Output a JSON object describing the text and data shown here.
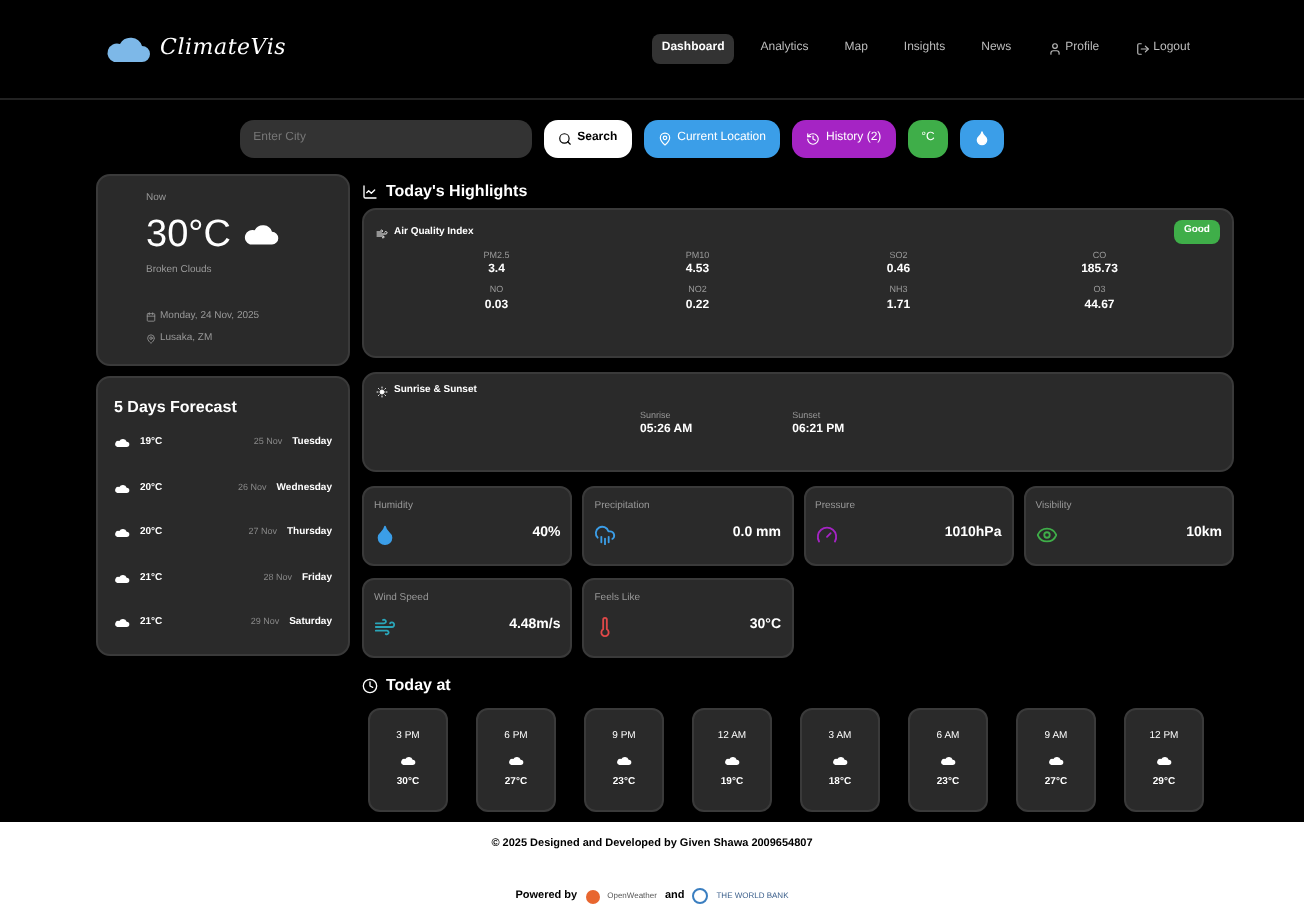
{
  "brand": {
    "name": "ClimateVis"
  },
  "nav": [
    {
      "label": "Dashboard",
      "selected": true,
      "kind": "link"
    },
    {
      "label": "Analytics",
      "selected": false,
      "kind": "link"
    },
    {
      "label": "Map",
      "selected": false,
      "kind": "link"
    },
    {
      "label": "Insights",
      "selected": false,
      "kind": "link"
    },
    {
      "label": "News",
      "selected": false,
      "kind": "link"
    },
    {
      "label": "Profile",
      "selected": false,
      "kind": "profile"
    },
    {
      "label": "Logout",
      "selected": false,
      "kind": "logout"
    }
  ],
  "search": {
    "placeholder": "Enter City"
  },
  "buttons": [
    {
      "kind": "search",
      "label": "Search"
    },
    {
      "kind": "location",
      "label": "Current Location"
    },
    {
      "kind": "history",
      "label": "History (2)"
    },
    {
      "kind": "unit",
      "label": "°C"
    },
    {
      "kind": "theme"
    }
  ],
  "current": {
    "label": "Now",
    "temp": "30°C",
    "condition": "Broken Clouds",
    "date": "Monday, 24 Nov, 2025",
    "location": "Lusaka, ZM"
  },
  "highlights_title": "Today's Highlights",
  "aqi": {
    "title": "Air Quality Index",
    "badge": "Good",
    "items": [
      {
        "label": "PM2.5",
        "value": "3.4"
      },
      {
        "label": "PM10",
        "value": "4.53"
      },
      {
        "label": "SO2",
        "value": "0.46"
      },
      {
        "label": "CO",
        "value": "185.73"
      },
      {
        "label": "NO",
        "value": "0.03"
      },
      {
        "label": "NO2",
        "value": "0.22"
      },
      {
        "label": "NH3",
        "value": "1.71"
      },
      {
        "label": "O3",
        "value": "44.67"
      }
    ]
  },
  "sun": {
    "title": "Sunrise & Sunset",
    "items": [
      {
        "label": "Sunrise",
        "value": "05:26 AM"
      },
      {
        "label": "Sunset",
        "value": "06:21 PM"
      }
    ]
  },
  "metrics": [
    {
      "kind": "humidity",
      "label": "Humidity",
      "value": "40%",
      "color": "#3b9ee8"
    },
    {
      "kind": "precipitation",
      "label": "Precipitation",
      "value": "0.0 mm",
      "color": "#3b9ee8"
    },
    {
      "kind": "pressure",
      "label": "Pressure",
      "value": "1010hPa",
      "color": "#a524c4"
    },
    {
      "kind": "visibility",
      "label": "Visibility",
      "value": "10km",
      "color": "#3fae49"
    },
    {
      "kind": "wind",
      "label": "Wind Speed",
      "value": "4.48m/s",
      "color": "#2aa5b8"
    },
    {
      "kind": "feels",
      "label": "Feels Like",
      "value": "30°C",
      "color": "#e04848"
    }
  ],
  "forecast": {
    "title": "5 Days Forecast",
    "days": [
      {
        "temp": "19°C",
        "date": "25 Nov",
        "day": "Tuesday"
      },
      {
        "temp": "20°C",
        "date": "26 Nov",
        "day": "Wednesday"
      },
      {
        "temp": "20°C",
        "date": "27 Nov",
        "day": "Thursday"
      },
      {
        "temp": "21°C",
        "date": "28 Nov",
        "day": "Friday"
      },
      {
        "temp": "21°C",
        "date": "29 Nov",
        "day": "Saturday"
      }
    ]
  },
  "today": {
    "title": "Today at",
    "hours": [
      {
        "time": "3 PM",
        "temp": "30°C"
      },
      {
        "time": "6 PM",
        "temp": "27°C"
      },
      {
        "time": "9 PM",
        "temp": "23°C"
      },
      {
        "time": "12 AM",
        "temp": "19°C"
      },
      {
        "time": "3 AM",
        "temp": "18°C"
      },
      {
        "time": "6 AM",
        "temp": "23°C"
      },
      {
        "time": "9 AM",
        "temp": "27°C"
      },
      {
        "time": "12 PM",
        "temp": "29°C"
      }
    ]
  },
  "footer": {
    "credit": "© 2025 Designed and Developed by Given Shawa 2009654807",
    "powered": "Powered by",
    "provider_1": "OpenWeather",
    "joiner": "and",
    "provider_2": "THE WORLD BANK"
  }
}
